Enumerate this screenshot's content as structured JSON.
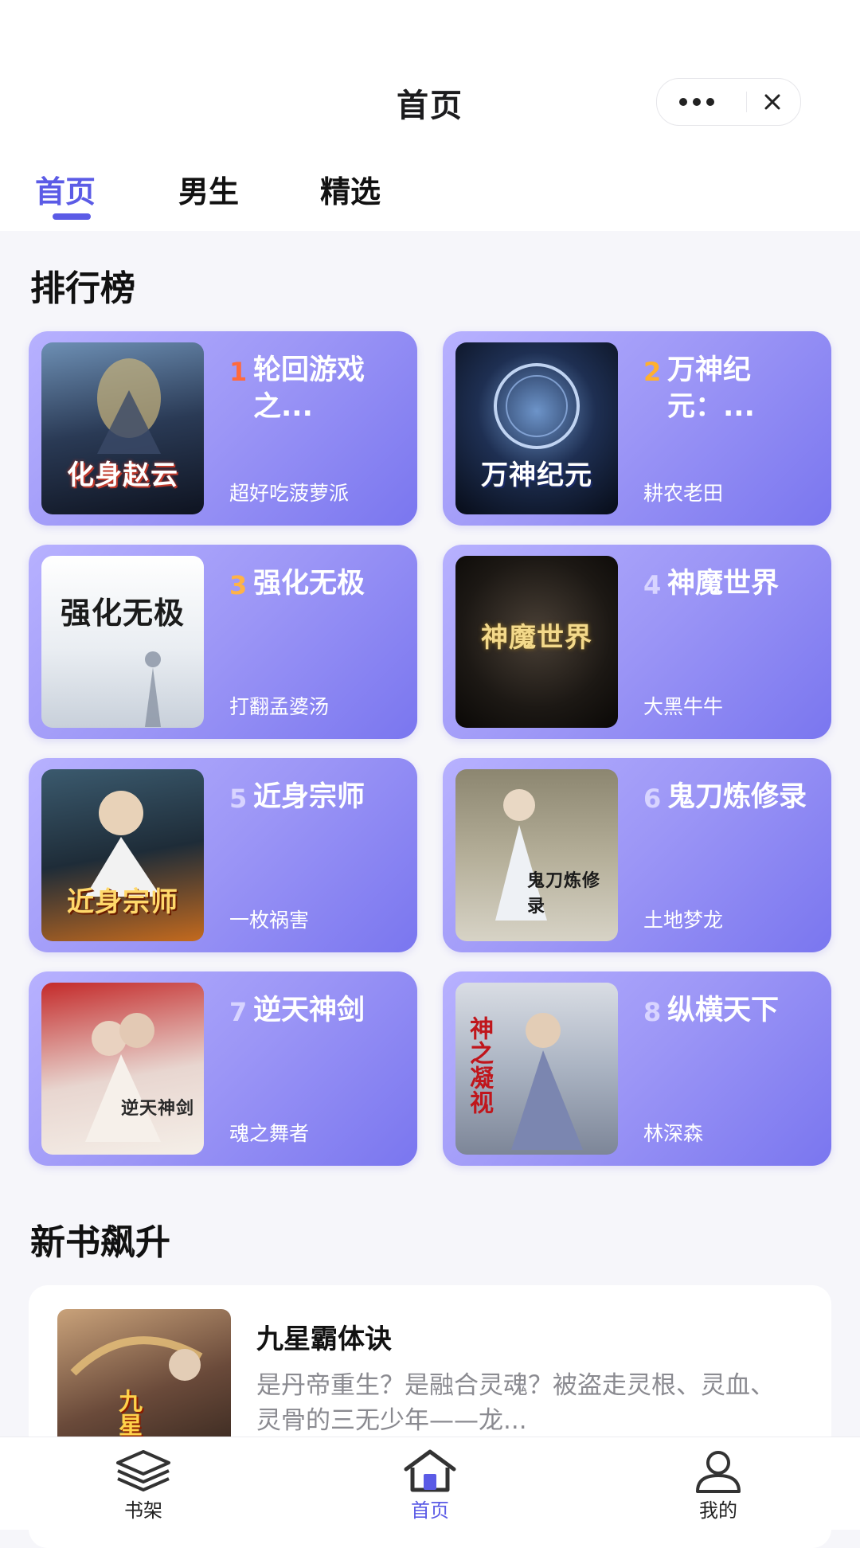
{
  "header": {
    "title": "首页"
  },
  "tabs": [
    {
      "label": "首页",
      "active": true
    },
    {
      "label": "男生"
    },
    {
      "label": "精选"
    }
  ],
  "ranking": {
    "title": "排行榜",
    "books": [
      {
        "rank": "1",
        "rank_color": "#ff6a3d",
        "title": "轮回游戏之...",
        "author": "超好吃菠萝派",
        "cover_text": "化身赵云"
      },
      {
        "rank": "2",
        "rank_color": "#ffb02e",
        "title": "万神纪元：...",
        "author": "耕农老田",
        "cover_text": "万神纪元"
      },
      {
        "rank": "3",
        "rank_color": "#ffb347",
        "title": "强化无极",
        "author": "打翻孟婆汤",
        "cover_text": "强化无极"
      },
      {
        "rank": "4",
        "rank_color": "#d8d4ff",
        "title": "神魔世界",
        "author": "大黑牛牛",
        "cover_text": "神魔世界"
      },
      {
        "rank": "5",
        "rank_color": "#d8d4ff",
        "title": "近身宗师",
        "author": "一枚祸害",
        "cover_text": "近身宗师"
      },
      {
        "rank": "6",
        "rank_color": "#d8d4ff",
        "title": "鬼刀炼修录",
        "author": "土地梦龙",
        "cover_text": "鬼刀炼修录"
      },
      {
        "rank": "7",
        "rank_color": "#d8d4ff",
        "title": "逆天神剑",
        "author": "魂之舞者",
        "cover_text": "逆天神剑"
      },
      {
        "rank": "8",
        "rank_color": "#d8d4ff",
        "title": "纵横天下",
        "author": "林深森",
        "cover_text": "神之凝视"
      }
    ]
  },
  "new_books": {
    "title": "新书飙升",
    "item": {
      "title": "九星霸体诀",
      "description": "是丹帝重生？是融合灵魂？被盗走灵根、灵血、灵骨的三无少年——龙...",
      "cover_text": "九星"
    }
  },
  "bottom_nav": [
    {
      "label": "书架",
      "icon": "layers-icon"
    },
    {
      "label": "首页",
      "icon": "home-icon",
      "active": true
    },
    {
      "label": "我的",
      "icon": "user-icon"
    }
  ],
  "colors": {
    "accent": "#5b5be6",
    "card_gradient_start": "#b7b1ff",
    "card_gradient_end": "#7a76ef"
  }
}
